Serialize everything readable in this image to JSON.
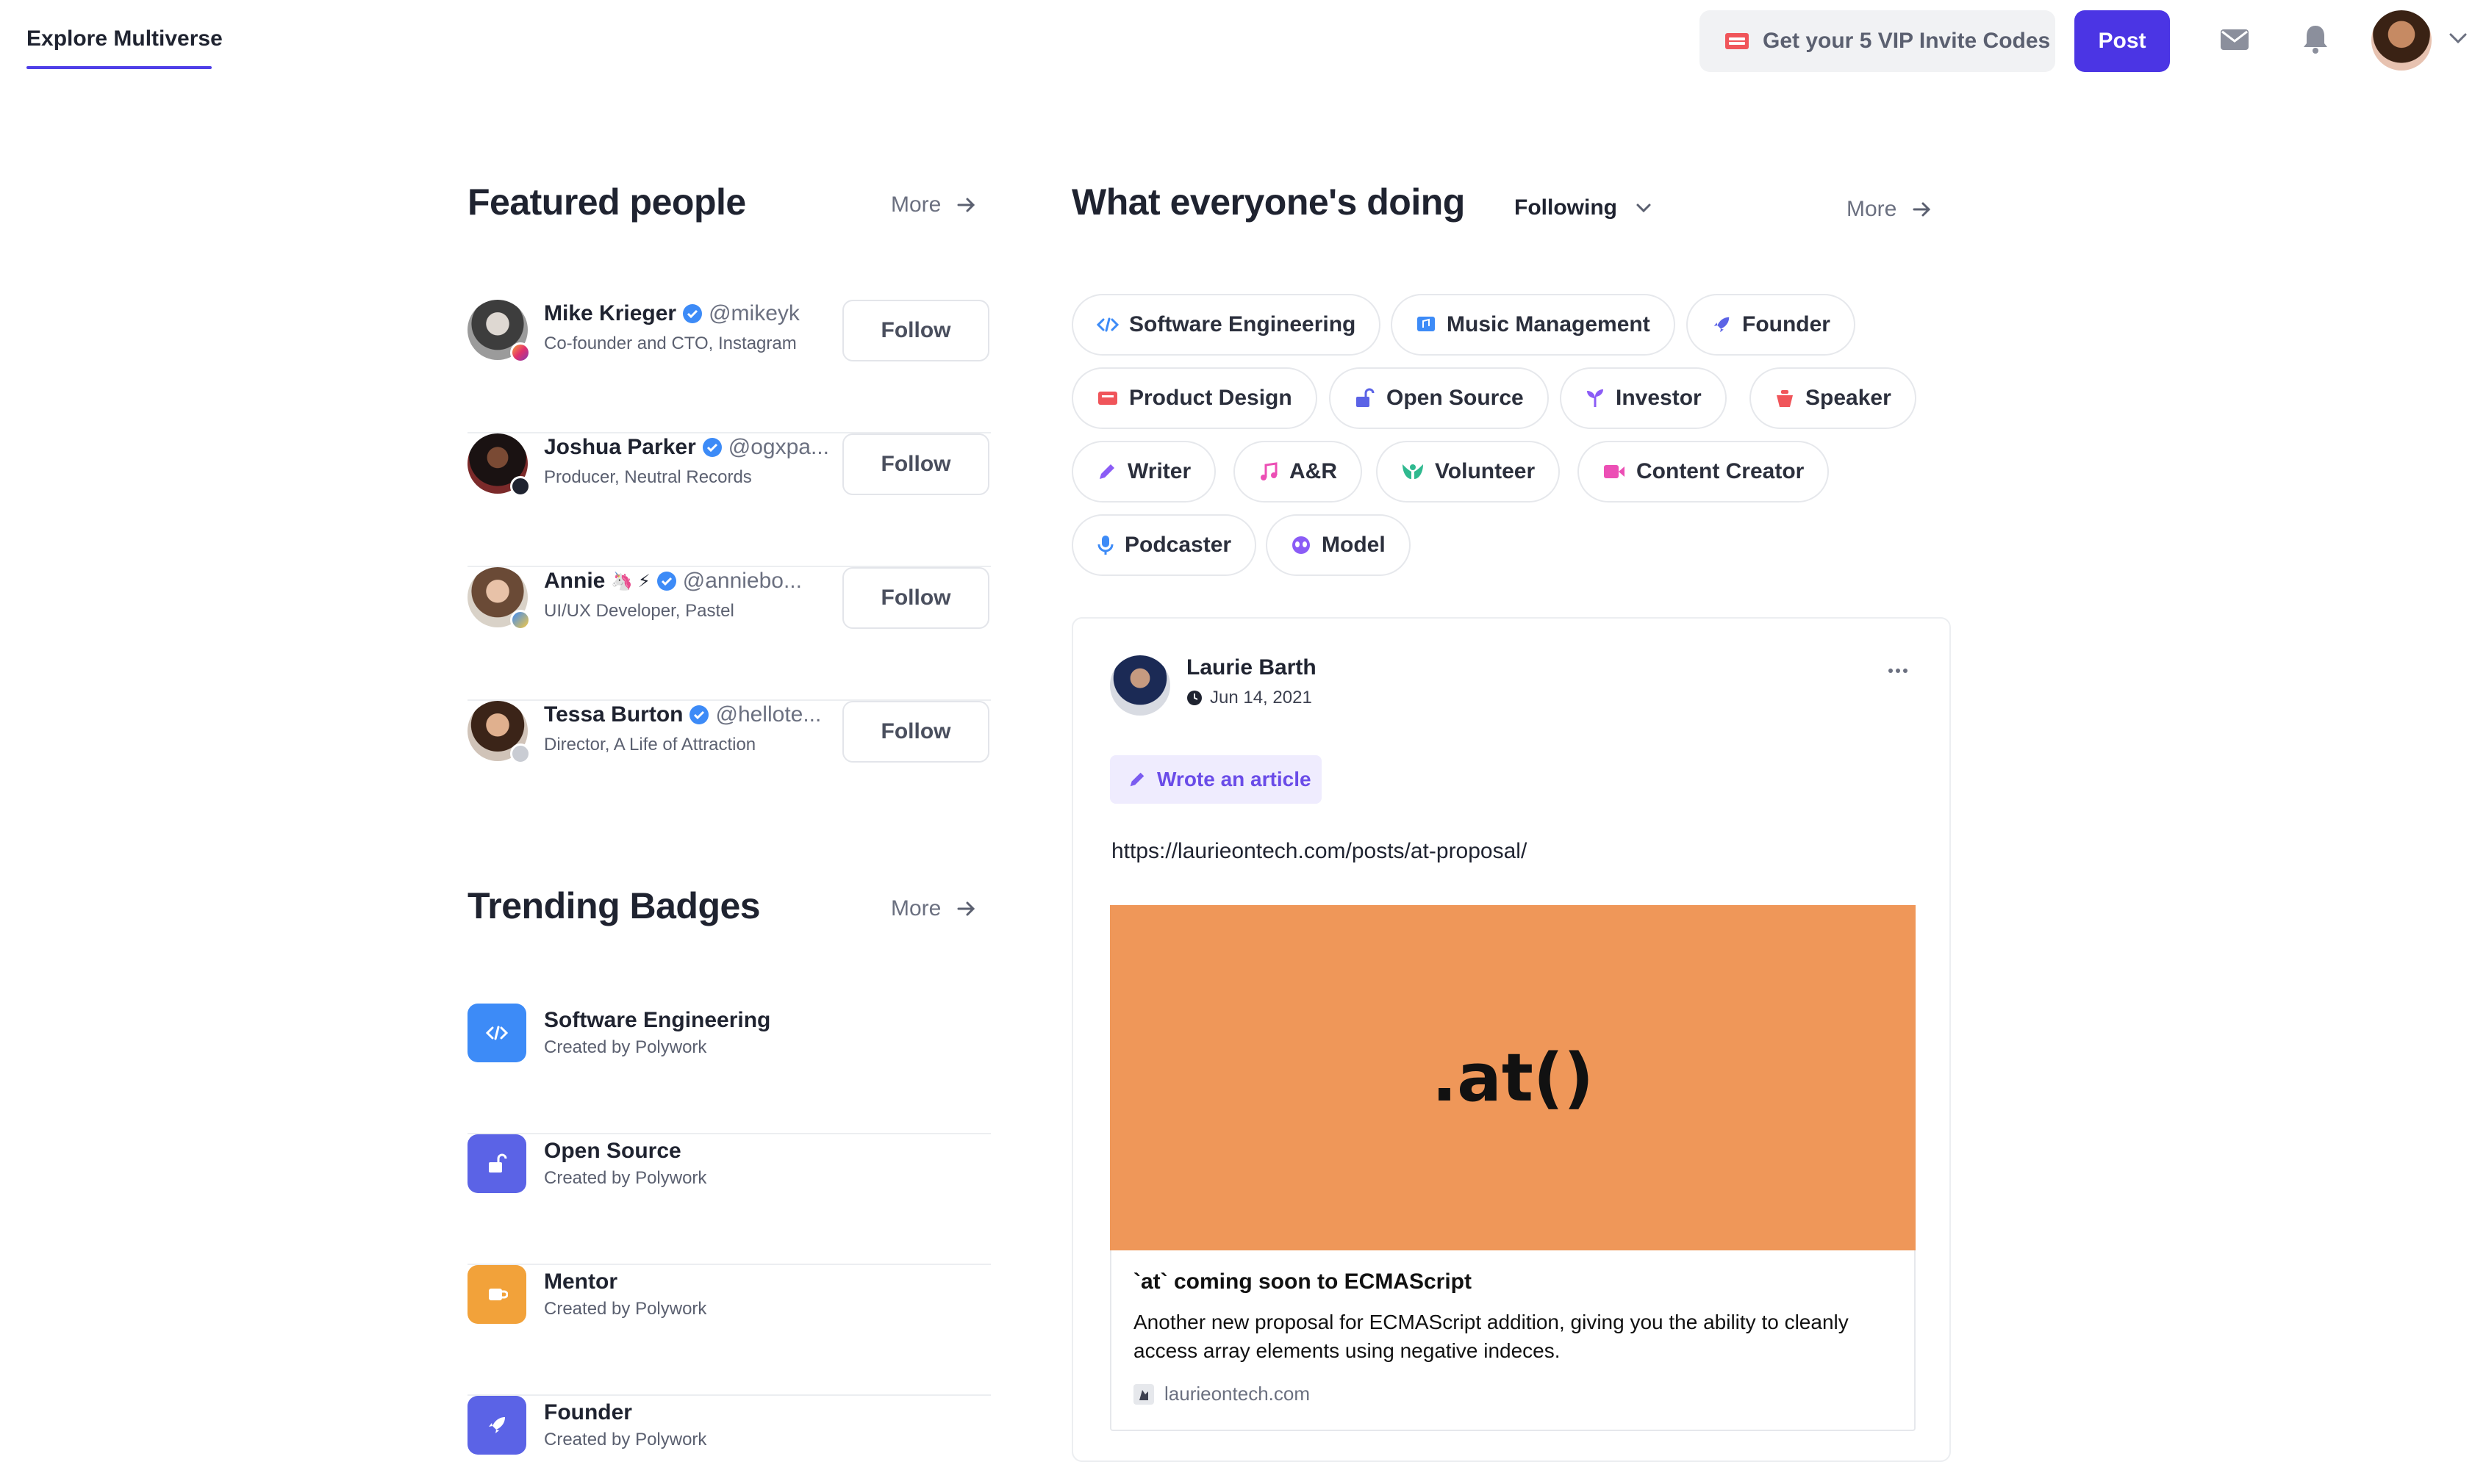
{
  "topnav": {
    "explore_label": "Explore Multiverse",
    "vip_label": "Get your 5 VIP Invite Codes",
    "post_label": "Post",
    "icons": [
      "mail-icon",
      "bell-icon",
      "chevron-down-icon"
    ]
  },
  "featured": {
    "title": "Featured people",
    "more_label": "More",
    "people": [
      {
        "name": "Mike Krieger",
        "handle": "@mikeyk",
        "subtitle": "Co-founder and CTO, Instagram",
        "follow_label": "Follow",
        "badge": "instagram-icon"
      },
      {
        "name": "Joshua Parker",
        "handle": "@ogxpa...",
        "subtitle": "Producer, Neutral Records",
        "follow_label": "Follow",
        "badge": "records-icon"
      },
      {
        "name": "Annie",
        "emoji": "🦄 ⚡",
        "handle": "@anniebo...",
        "subtitle": "UI/UX Developer, Pastel",
        "follow_label": "Follow",
        "badge": "pastel-icon"
      },
      {
        "name": "Tessa Burton",
        "handle": "@hellote...",
        "subtitle": "Director, A Life of Attraction",
        "follow_label": "Follow",
        "badge": "film-icon"
      }
    ]
  },
  "trending": {
    "title": "Trending Badges",
    "more_label": "More",
    "badges": [
      {
        "name": "Software Engineering",
        "creator": "Created by Polywork",
        "color": "#3d8bf7"
      },
      {
        "name": "Open Source",
        "creator": "Created by Polywork",
        "color": "#5b63e6"
      },
      {
        "name": "Mentor",
        "creator": "Created by Polywork",
        "color": "#f2a23a"
      },
      {
        "name": "Founder",
        "creator": "Created by Polywork",
        "color": "#5b63e6"
      }
    ]
  },
  "feed": {
    "title": "What everyone's doing",
    "filter_label": "Following",
    "more_label": "More",
    "tags": [
      {
        "label": "Software Engineering",
        "icon": "code-icon",
        "color": "#3d8bf7"
      },
      {
        "label": "Music Management",
        "icon": "music-management-icon",
        "color": "#3d8bf7"
      },
      {
        "label": "Founder",
        "icon": "rocket-icon",
        "color": "#5b63e6"
      },
      {
        "label": "Product Design",
        "icon": "design-icon",
        "color": "#f0555a"
      },
      {
        "label": "Open Source",
        "icon": "unlock-icon",
        "color": "#5b63e6"
      },
      {
        "label": "Investor",
        "icon": "sprout-icon",
        "color": "#8b5cf6"
      },
      {
        "label": "Speaker",
        "icon": "podium-icon",
        "color": "#f0555a"
      },
      {
        "label": "Writer",
        "icon": "pen-icon",
        "color": "#8b5cf6"
      },
      {
        "label": "A&R",
        "icon": "music-note-icon",
        "color": "#ec4fb5"
      },
      {
        "label": "Volunteer",
        "icon": "hands-icon",
        "color": "#2fb98f"
      },
      {
        "label": "Content Creator",
        "icon": "video-icon",
        "color": "#ec4fb5"
      },
      {
        "label": "Podcaster",
        "icon": "mic-icon",
        "color": "#3d8bf7"
      },
      {
        "label": "Model",
        "icon": "alien-icon",
        "color": "#8b5cf6"
      }
    ],
    "post": {
      "author": "Laurie Barth",
      "date": "Jun 14, 2021",
      "activity_label": "Wrote an article",
      "url": "https://laurieontech.com/posts/at-proposal/",
      "preview_image_text": ".at()",
      "preview_title": "`at` coming soon to ECMAScript",
      "preview_description": "Another new proposal for ECMAScript addition, giving you the ability to cleanly access array elements using negative indeces.",
      "preview_domain": "laurieontech.com"
    }
  },
  "colors": {
    "accent": "#4b35e4",
    "preview_bg": "#ef9759"
  }
}
